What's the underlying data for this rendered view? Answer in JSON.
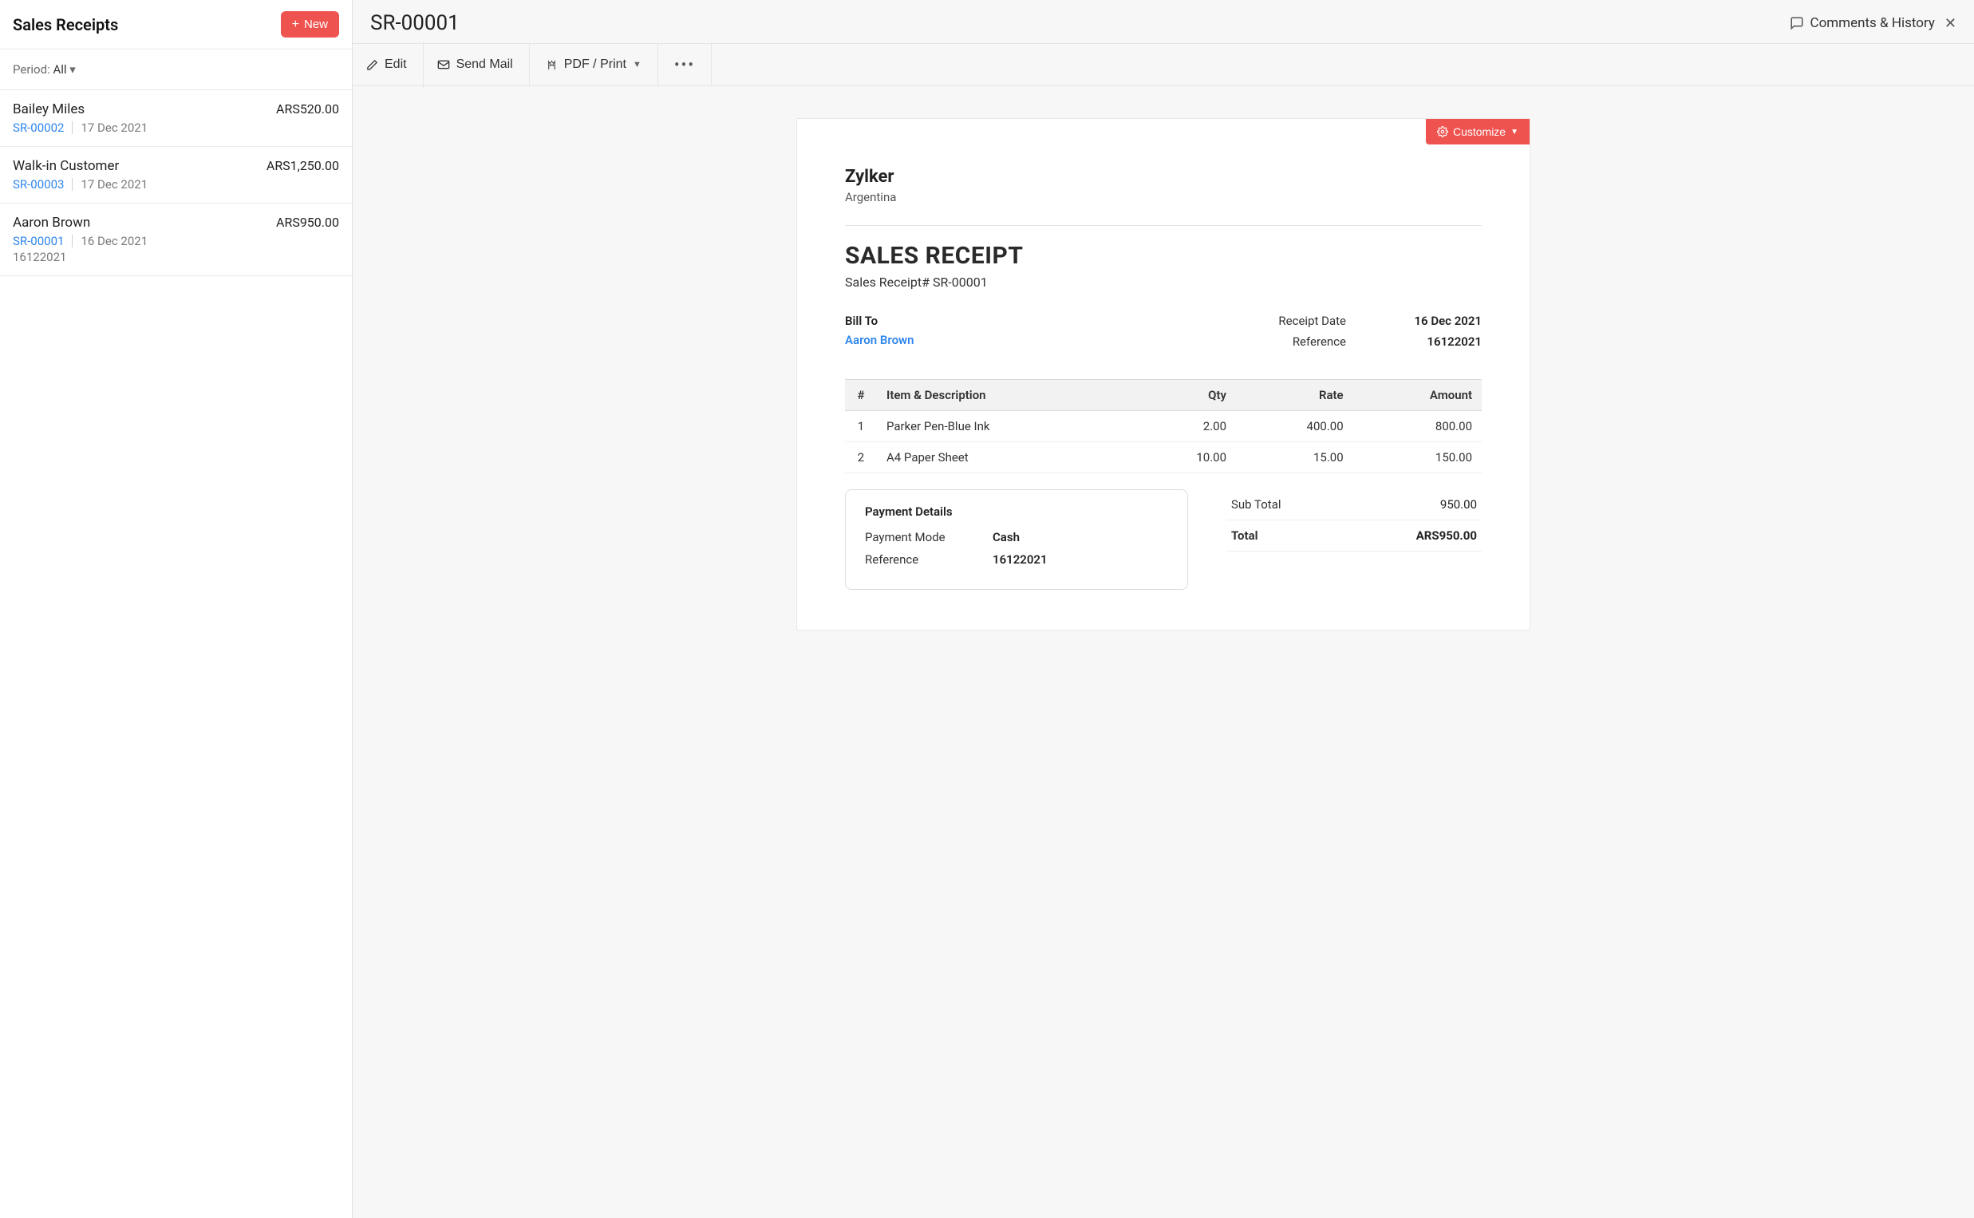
{
  "sidebar": {
    "title": "Sales Receipts",
    "new_label": "New",
    "period_label": "Period:",
    "period_value": "All",
    "items": [
      {
        "customer": "Bailey Miles",
        "amount": "ARS520.00",
        "sr": "SR-00002",
        "date": "17 Dec 2021",
        "ref": ""
      },
      {
        "customer": "Walk-in Customer",
        "amount": "ARS1,250.00",
        "sr": "SR-00003",
        "date": "17 Dec 2021",
        "ref": ""
      },
      {
        "customer": "Aaron Brown",
        "amount": "ARS950.00",
        "sr": "SR-00001",
        "date": "16 Dec 2021",
        "ref": "16122021"
      }
    ]
  },
  "detail": {
    "title": "SR-00001",
    "comments_label": "Comments & History",
    "toolbar": {
      "edit": "Edit",
      "send_mail": "Send Mail",
      "pdf_print": "PDF / Print"
    }
  },
  "doc": {
    "customize_label": "Customize",
    "company": "Zylker",
    "country": "Argentina",
    "heading": "SALES RECEIPT",
    "receipt_num_label": "Sales Receipt# SR-00001",
    "bill_to_label": "Bill To",
    "bill_to_customer": "Aaron Brown",
    "receipt_date_label": "Receipt Date",
    "receipt_date": "16 Dec 2021",
    "reference_label": "Reference",
    "reference": "16122021",
    "cols": {
      "num": "#",
      "desc": "Item & Description",
      "qty": "Qty",
      "rate": "Rate",
      "amount": "Amount"
    },
    "lines": [
      {
        "num": "1",
        "desc": "Parker Pen-Blue Ink",
        "qty": "2.00",
        "rate": "400.00",
        "amount": "800.00"
      },
      {
        "num": "2",
        "desc": "A4 Paper Sheet",
        "qty": "10.00",
        "rate": "15.00",
        "amount": "150.00"
      }
    ],
    "payment": {
      "title": "Payment Details",
      "mode_label": "Payment Mode",
      "mode": "Cash",
      "ref_label": "Reference",
      "ref": "16122021"
    },
    "totals": {
      "subtotal_label": "Sub Total",
      "subtotal": "950.00",
      "total_label": "Total",
      "total": "ARS950.00"
    }
  }
}
